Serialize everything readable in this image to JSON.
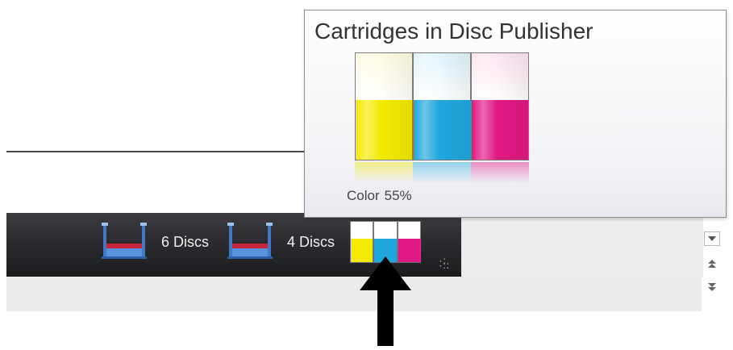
{
  "popup": {
    "title": "Cartridges in Disc Publisher",
    "status_label": "Color",
    "status_value": "55%",
    "cartridges": [
      {
        "name": "yellow-cartridge",
        "color": "#f2ea00",
        "empty_color": "#fffbe0",
        "level": 0.55
      },
      {
        "name": "cyan-cartridge",
        "color": "#1fa7dd",
        "empty_color": "#dff3fa",
        "level": 0.55
      },
      {
        "name": "magenta-cartridge",
        "color": "#e01883",
        "empty_color": "#fbe3ef",
        "level": 0.55
      }
    ]
  },
  "toolbar": {
    "bin1": {
      "icon": "disc-bin-icon",
      "label": "6 Discs"
    },
    "bin2": {
      "icon": "disc-bin-icon",
      "label": "4 Discs"
    },
    "ink_indicator": {
      "icon": "ink-cartridges-icon",
      "colors": [
        "#f2ea00",
        "#1fa7dd",
        "#e01883"
      ],
      "level": 0.55
    },
    "grip_icon": "resize-grip-icon"
  },
  "scroll_controls": {
    "dropdown_icon": "chevron-down-icon",
    "up_icon": "double-chevron-up-icon",
    "down_icon": "double-chevron-down-icon"
  },
  "annotation": {
    "icon": "arrow-up-icon",
    "color": "#000000"
  }
}
